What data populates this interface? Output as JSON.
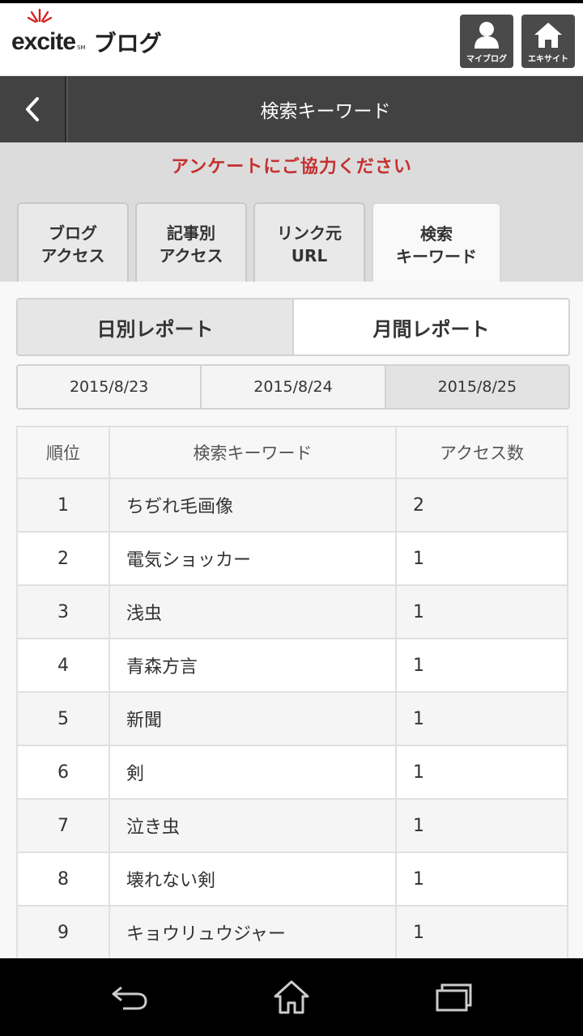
{
  "header": {
    "logo_text": "excite",
    "logo_sub": "ブログ",
    "myblog_label": "マイブログ",
    "site_label": "エキサイト",
    "colors": {
      "header_bg": "#ffffff",
      "button_bg": "#4a4a4a"
    }
  },
  "titlebar": {
    "title": "検索キーワード",
    "back_icon": "chevron-left-icon"
  },
  "survey_text": "アンケートにご協力ください",
  "tabs": [
    {
      "line1": "ブログ",
      "line2": "アクセス",
      "active": false
    },
    {
      "line1": "記事別",
      "line2": "アクセス",
      "active": false
    },
    {
      "line1": "リンク元",
      "line2": "URL",
      "active": false
    },
    {
      "line1": "検索",
      "line2": "キーワード",
      "active": true
    }
  ],
  "report_toggle": {
    "daily": "日別レポート",
    "monthly": "月間レポート",
    "selected": "daily"
  },
  "dates": [
    "2015/8/23",
    "2015/8/24",
    "2015/8/25"
  ],
  "selected_date": "2015/8/25",
  "table": {
    "headers": [
      "順位",
      "検索キーワード",
      "アクセス数"
    ],
    "rows": [
      {
        "rank": "1",
        "keyword": "ちぢれ毛画像",
        "count": "2"
      },
      {
        "rank": "2",
        "keyword": "電気ショッカー",
        "count": "1"
      },
      {
        "rank": "3",
        "keyword": "浅虫",
        "count": "1"
      },
      {
        "rank": "4",
        "keyword": "青森方言",
        "count": "1"
      },
      {
        "rank": "5",
        "keyword": "新聞",
        "count": "1"
      },
      {
        "rank": "6",
        "keyword": "剣",
        "count": "1"
      },
      {
        "rank": "7",
        "keyword": "泣き虫",
        "count": "1"
      },
      {
        "rank": "8",
        "keyword": "壊れない剣",
        "count": "1"
      },
      {
        "rank": "9",
        "keyword": "キョウリュウジャー",
        "count": "1"
      }
    ]
  },
  "accent_color": "#c53030"
}
